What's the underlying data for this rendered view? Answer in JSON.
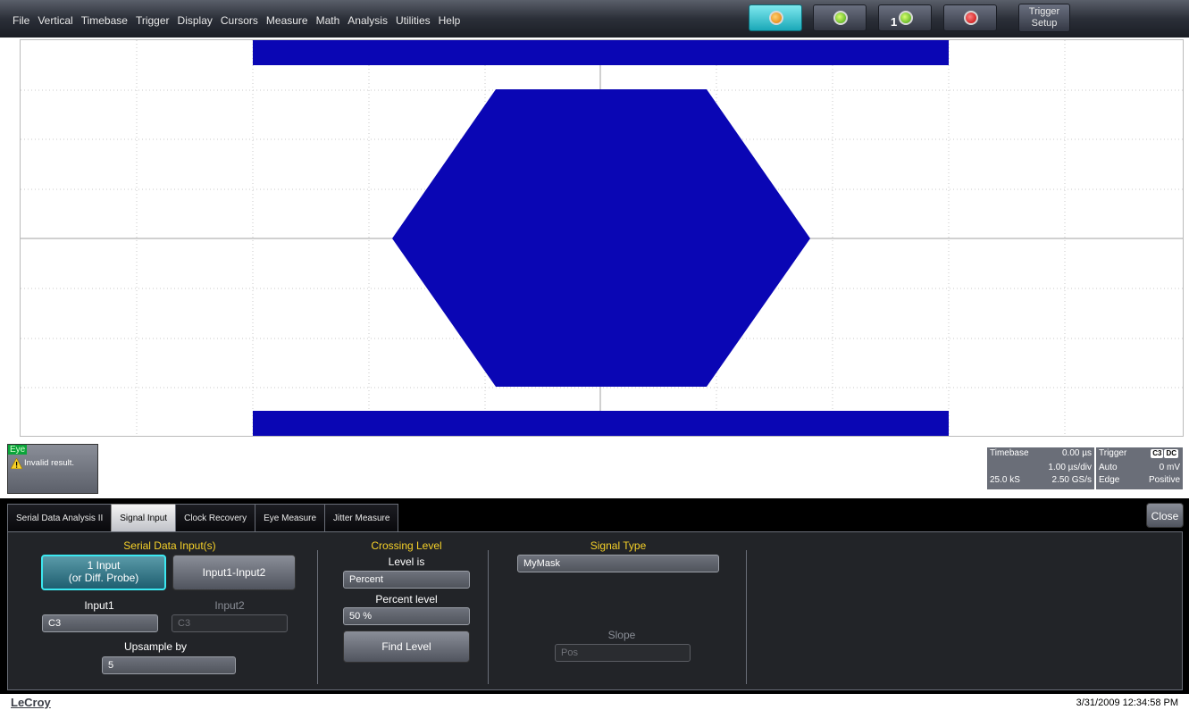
{
  "menu": [
    "File",
    "Vertical",
    "Timebase",
    "Trigger",
    "Display",
    "Cursors",
    "Measure",
    "Math",
    "Analysis",
    "Utilities",
    "Help"
  ],
  "toolbar": {
    "trigger_setup_line1": "Trigger",
    "trigger_setup_line2": "Setup",
    "single_number": "1"
  },
  "descriptor": {
    "tag": "Eye",
    "message": "Invalid result."
  },
  "timebase": {
    "label": "Timebase",
    "delay": "0.00 µs",
    "per_div": "1.00 µs/div",
    "samples": "25.0 kS",
    "rate": "2.50 GS/s"
  },
  "trigger": {
    "label": "Trigger",
    "channel": "C3",
    "coupling": "DC",
    "mode": "Auto",
    "level": "0 mV",
    "type": "Edge",
    "slope": "Positive"
  },
  "tabs": [
    "Serial Data Analysis II",
    "Signal Input",
    "Clock Recovery",
    "Eye Measure",
    "Jitter Measure"
  ],
  "close_label": "Close",
  "serial_input": {
    "title": "Serial Data Input(s)",
    "btn1_line1": "1 Input",
    "btn1_line2": "(or Diff. Probe)",
    "btn2": "Input1-Input2",
    "input1_label": "Input1",
    "input1_value": "C3",
    "input2_label": "Input2",
    "input2_value": "C3",
    "upsample_label": "Upsample by",
    "upsample_value": "5"
  },
  "crossing": {
    "title": "Crossing Level",
    "level_is_label": "Level is",
    "level_is_value": "Percent",
    "percent_label": "Percent level",
    "percent_value": "50 %",
    "find_btn": "Find Level"
  },
  "signal_type": {
    "title": "Signal Type",
    "value": "MyMask",
    "slope_label": "Slope",
    "slope_value": "Pos"
  },
  "footer": {
    "brand": "LeCroy",
    "timestamp": "3/31/2009 12:34:58 PM"
  },
  "colors": {
    "mask": "#0a06b4",
    "accent": "#f6d128",
    "active": "#3ce8f0"
  }
}
